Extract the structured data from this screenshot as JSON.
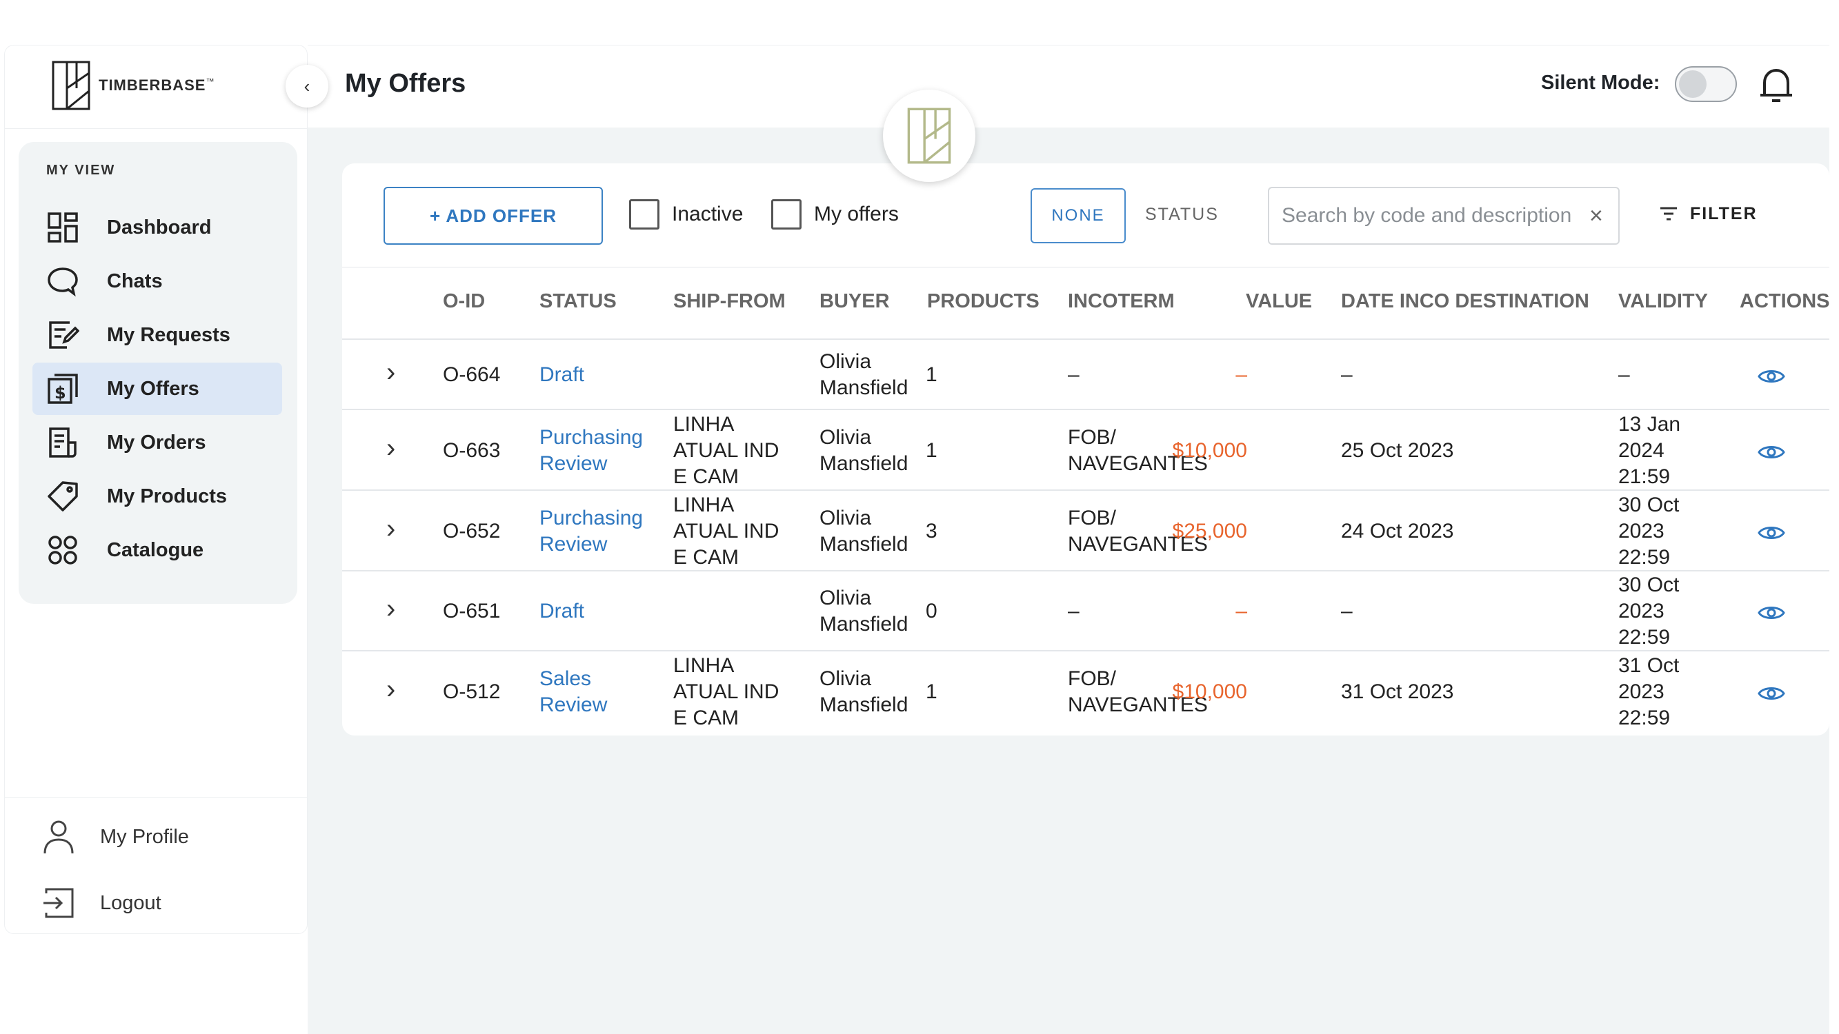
{
  "brand": {
    "name": "TIMBERBASE",
    "tm": "™"
  },
  "sidebar": {
    "section_title": "MY VIEW",
    "items": [
      {
        "label": "Dashboard",
        "icon": "dashboard-icon"
      },
      {
        "label": "Chats",
        "icon": "chat-icon"
      },
      {
        "label": "My Requests",
        "icon": "requests-icon"
      },
      {
        "label": "My Offers",
        "icon": "offers-icon",
        "active": true
      },
      {
        "label": "My Orders",
        "icon": "orders-icon"
      },
      {
        "label": "My Products",
        "icon": "tag-icon"
      },
      {
        "label": "Catalogue",
        "icon": "grid-icon"
      }
    ],
    "bottom": [
      {
        "label": "My Profile",
        "icon": "user-icon"
      },
      {
        "label": "Logout",
        "icon": "logout-icon"
      }
    ]
  },
  "header": {
    "title": "My Offers",
    "silent_mode_label": "Silent Mode:",
    "silent_mode_on": false
  },
  "toolbar": {
    "add_offer_label": "+ ADD OFFER",
    "inactive_label": "Inactive",
    "my_offers_label": "My offers",
    "none_label": "NONE",
    "status_label": "STATUS",
    "search_placeholder": "Search by code and description",
    "filter_label": "FILTER"
  },
  "table": {
    "headers": {
      "oid": "O-ID",
      "status": "STATUS",
      "shipfrom": "SHIP-FROM",
      "buyer": "BUYER",
      "products": "PRODUCTS",
      "incoterm": "INCOTERM",
      "value": "VALUE",
      "date": "DATE INCO DESTINATION",
      "validity": "VALIDITY",
      "actions": "ACTIONS"
    },
    "rows": [
      {
        "oid": "O-664",
        "status": "Draft",
        "shipfrom": "",
        "buyer": "Olivia\nMansfield",
        "products": "1",
        "incoterm": "–",
        "value": "–",
        "date": "–",
        "validity": "–"
      },
      {
        "oid": "O-663",
        "status": "Purchasing\nReview",
        "shipfrom": "LINHA\nATUAL IND\nE CAM",
        "buyer": "Olivia\nMansfield",
        "products": "1",
        "incoterm": "FOB/\nNAVEGANTES",
        "value": "$10,000",
        "date": "25 Oct 2023",
        "validity": "13 Jan\n2024\n21:59"
      },
      {
        "oid": "O-652",
        "status": "Purchasing\nReview",
        "shipfrom": "LINHA\nATUAL IND\nE CAM",
        "buyer": "Olivia\nMansfield",
        "products": "3",
        "incoterm": "FOB/\nNAVEGANTES",
        "value": "$25,000",
        "date": "24 Oct 2023",
        "validity": "30 Oct\n2023\n22:59"
      },
      {
        "oid": "O-651",
        "status": "Draft",
        "shipfrom": "",
        "buyer": "Olivia\nMansfield",
        "products": "0",
        "incoterm": "–",
        "value": "–",
        "date": "–",
        "validity": "30 Oct\n2023\n22:59"
      },
      {
        "oid": "O-512",
        "status": "Sales\nReview",
        "shipfrom": "LINHA\nATUAL IND\nE CAM",
        "buyer": "Olivia\nMansfield",
        "products": "1",
        "incoterm": "FOB/\nNAVEGANTES",
        "value": "$10,000",
        "date": "31 Oct 2023",
        "validity": "31 Oct\n2023\n22:59"
      }
    ]
  },
  "colors": {
    "accent": "#2f77bf",
    "value": "#e8652e",
    "active_nav": "#dce7f6",
    "background": "#f1f4f5"
  }
}
